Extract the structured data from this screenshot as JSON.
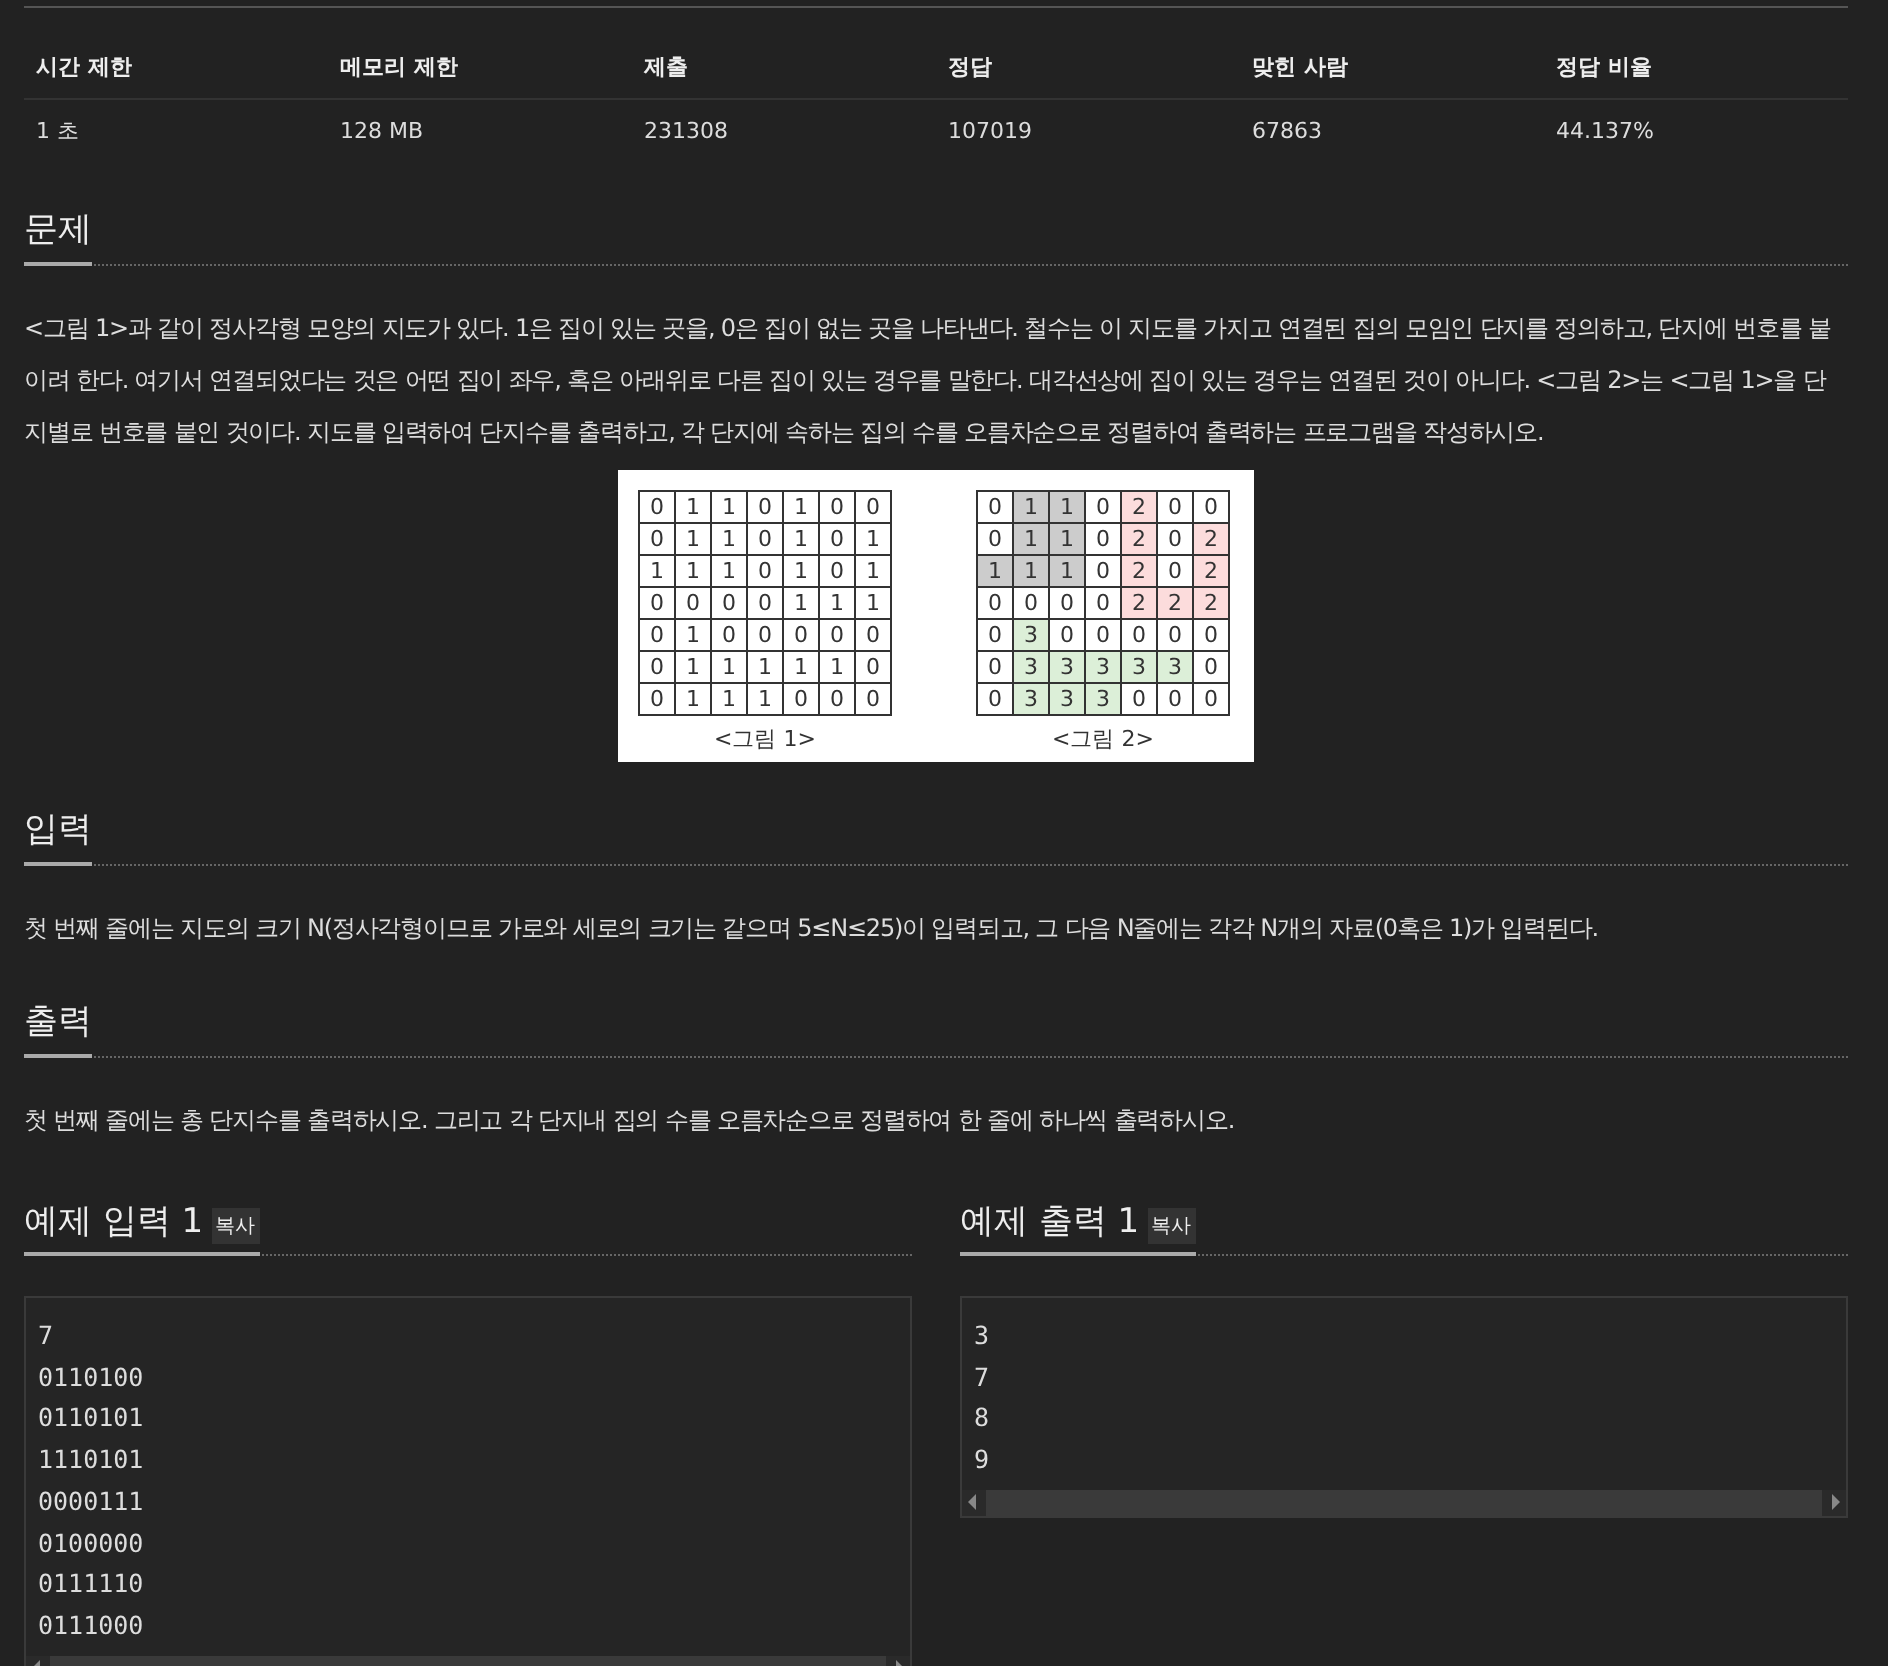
{
  "stats": {
    "columns": [
      "시간 제한",
      "메모리 제한",
      "제출",
      "정답",
      "맞힌 사람",
      "정답 비율"
    ],
    "values": [
      "1 초",
      "128 MB",
      "231308",
      "107019",
      "67863",
      "44.137%"
    ]
  },
  "problem": {
    "heading": "문제",
    "text": "<그림 1>과 같이 정사각형 모양의 지도가 있다. 1은 집이 있는 곳을, 0은 집이 없는 곳을 나타낸다. 철수는 이 지도를 가지고 연결된 집의 모임인 단지를 정의하고, 단지에 번호를 붙이려 한다. 여기서 연결되었다는 것은 어떤 집이 좌우, 혹은 아래위로 다른 집이 있는 경우를 말한다. 대각선상에 집이 있는 경우는 연결된 것이 아니다. <그림 2>는 <그림 1>을 단지별로 번호를 붙인 것이다. 지도를 입력하여 단지수를 출력하고, 각 단지에 속하는 집의 수를 오름차순으로 정렬하여 출력하는 프로그램을 작성하시오.",
    "figures": [
      {
        "caption": "<그림 1>",
        "rows": [
          [
            {
              "v": "0"
            },
            {
              "v": "1"
            },
            {
              "v": "1"
            },
            {
              "v": "0"
            },
            {
              "v": "1"
            },
            {
              "v": "0"
            },
            {
              "v": "0"
            }
          ],
          [
            {
              "v": "0"
            },
            {
              "v": "1"
            },
            {
              "v": "1"
            },
            {
              "v": "0"
            },
            {
              "v": "1"
            },
            {
              "v": "0"
            },
            {
              "v": "1"
            }
          ],
          [
            {
              "v": "1"
            },
            {
              "v": "1"
            },
            {
              "v": "1"
            },
            {
              "v": "0"
            },
            {
              "v": "1"
            },
            {
              "v": "0"
            },
            {
              "v": "1"
            }
          ],
          [
            {
              "v": "0"
            },
            {
              "v": "0"
            },
            {
              "v": "0"
            },
            {
              "v": "0"
            },
            {
              "v": "1"
            },
            {
              "v": "1"
            },
            {
              "v": "1"
            }
          ],
          [
            {
              "v": "0"
            },
            {
              "v": "1"
            },
            {
              "v": "0"
            },
            {
              "v": "0"
            },
            {
              "v": "0"
            },
            {
              "v": "0"
            },
            {
              "v": "0"
            }
          ],
          [
            {
              "v": "0"
            },
            {
              "v": "1"
            },
            {
              "v": "1"
            },
            {
              "v": "1"
            },
            {
              "v": "1"
            },
            {
              "v": "1"
            },
            {
              "v": "0"
            }
          ],
          [
            {
              "v": "0"
            },
            {
              "v": "1"
            },
            {
              "v": "1"
            },
            {
              "v": "1"
            },
            {
              "v": "0"
            },
            {
              "v": "0"
            },
            {
              "v": "0"
            }
          ]
        ]
      },
      {
        "caption": "<그림 2>",
        "rows": [
          [
            {
              "v": "0"
            },
            {
              "v": "1",
              "color": "#cccccc"
            },
            {
              "v": "1",
              "color": "#cccccc"
            },
            {
              "v": "0"
            },
            {
              "v": "2",
              "color": "#fcdcdc"
            },
            {
              "v": "0"
            },
            {
              "v": "0"
            }
          ],
          [
            {
              "v": "0"
            },
            {
              "v": "1",
              "color": "#cccccc"
            },
            {
              "v": "1",
              "color": "#cccccc"
            },
            {
              "v": "0"
            },
            {
              "v": "2",
              "color": "#fcdcdc"
            },
            {
              "v": "0"
            },
            {
              "v": "2",
              "color": "#fcdcdc"
            }
          ],
          [
            {
              "v": "1",
              "color": "#cccccc"
            },
            {
              "v": "1",
              "color": "#cccccc"
            },
            {
              "v": "1",
              "color": "#cccccc"
            },
            {
              "v": "0"
            },
            {
              "v": "2",
              "color": "#fcdcdc"
            },
            {
              "v": "0"
            },
            {
              "v": "2",
              "color": "#fcdcdc"
            }
          ],
          [
            {
              "v": "0"
            },
            {
              "v": "0"
            },
            {
              "v": "0"
            },
            {
              "v": "0"
            },
            {
              "v": "2",
              "color": "#fcdcdc"
            },
            {
              "v": "2",
              "color": "#fcdcdc"
            },
            {
              "v": "2",
              "color": "#fcdcdc"
            }
          ],
          [
            {
              "v": "0"
            },
            {
              "v": "3",
              "color": "#dcefd8"
            },
            {
              "v": "0"
            },
            {
              "v": "0"
            },
            {
              "v": "0"
            },
            {
              "v": "0"
            },
            {
              "v": "0"
            }
          ],
          [
            {
              "v": "0"
            },
            {
              "v": "3",
              "color": "#dcefd8"
            },
            {
              "v": "3",
              "color": "#dcefd8"
            },
            {
              "v": "3",
              "color": "#dcefd8"
            },
            {
              "v": "3",
              "color": "#dcefd8"
            },
            {
              "v": "3",
              "color": "#dcefd8"
            },
            {
              "v": "0"
            }
          ],
          [
            {
              "v": "0"
            },
            {
              "v": "3",
              "color": "#dcefd8"
            },
            {
              "v": "3",
              "color": "#dcefd8"
            },
            {
              "v": "3",
              "color": "#dcefd8"
            },
            {
              "v": "0"
            },
            {
              "v": "0"
            },
            {
              "v": "0"
            }
          ]
        ]
      }
    ]
  },
  "input": {
    "heading": "입력",
    "text": "첫 번째 줄에는 지도의 크기 N(정사각형이므로 가로와 세로의 크기는 같으며 5≤N≤25)이 입력되고, 그 다음 N줄에는 각각 N개의 자료(0혹은 1)가 입력된다."
  },
  "output": {
    "heading": "출력",
    "text": "첫 번째 줄에는 총 단지수를 출력하시오. 그리고 각 단지내 집의 수를 오름차순으로 정렬하여 한 줄에 하나씩 출력하시오."
  },
  "samples": [
    {
      "heading": "예제 입력 1",
      "copy": "복사",
      "lines": [
        "7",
        "0110100",
        "0110101",
        "1110101",
        "0000111",
        "0100000",
        "0111110",
        "0111000"
      ]
    },
    {
      "heading": "예제 출력 1",
      "copy": "복사",
      "lines": [
        "3",
        "7",
        "8",
        "9"
      ]
    }
  ]
}
